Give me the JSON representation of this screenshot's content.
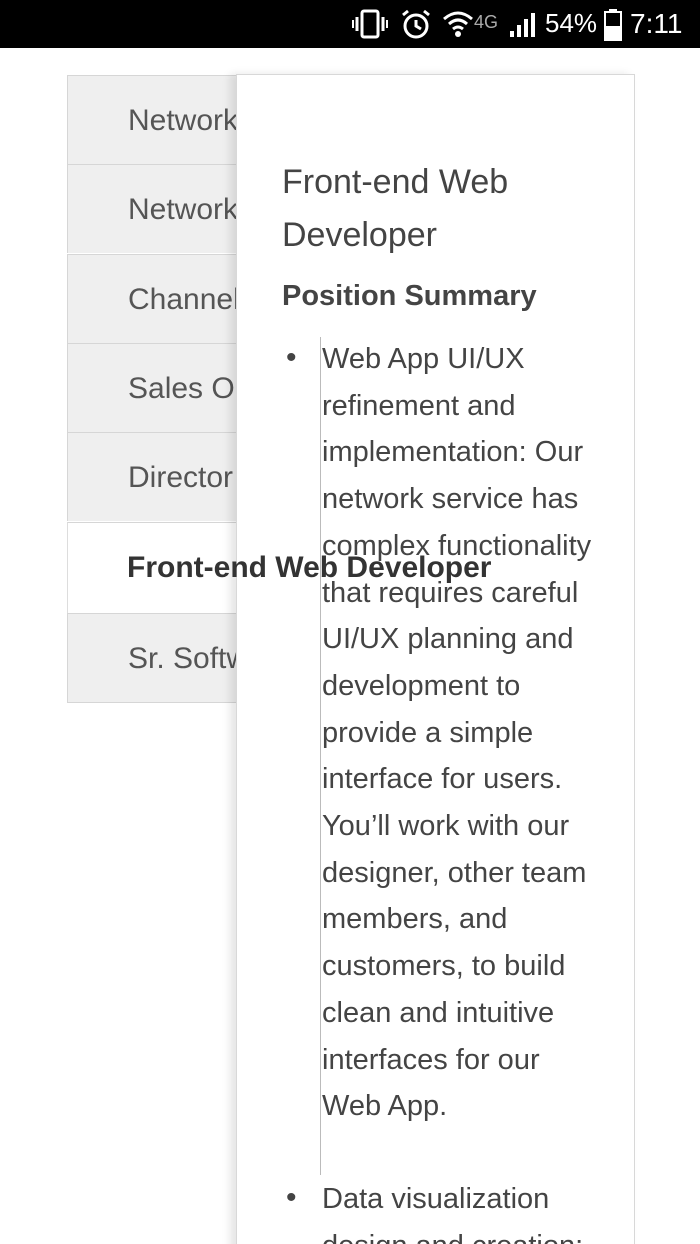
{
  "status_bar": {
    "network_type": "4G",
    "battery": "54%",
    "time": "7:11"
  },
  "tabs": [
    {
      "label": "Network",
      "active": false
    },
    {
      "label": "Network",
      "active": false
    },
    {
      "label": "Channel",
      "active": false
    },
    {
      "label": "Sales Op",
      "active": false
    },
    {
      "label": "Director",
      "active": false
    },
    {
      "label": "Front-end Web Developer",
      "active": true
    },
    {
      "label": "Sr. Softw",
      "active": false
    }
  ],
  "job": {
    "title_line1": "Front-end Web",
    "title_line2": "Developer",
    "section_title": "Position Summary",
    "bullets": [
      "Web App UI/UX refinement and implementation: Our network service has complex functionality that requires careful UI/UX planning and development to provide a simple interface for users. You’ll work with our designer, other team members, and customers, to build clean and intuitive interfaces for our Web App.",
      "Data visualization design and creation:"
    ]
  }
}
